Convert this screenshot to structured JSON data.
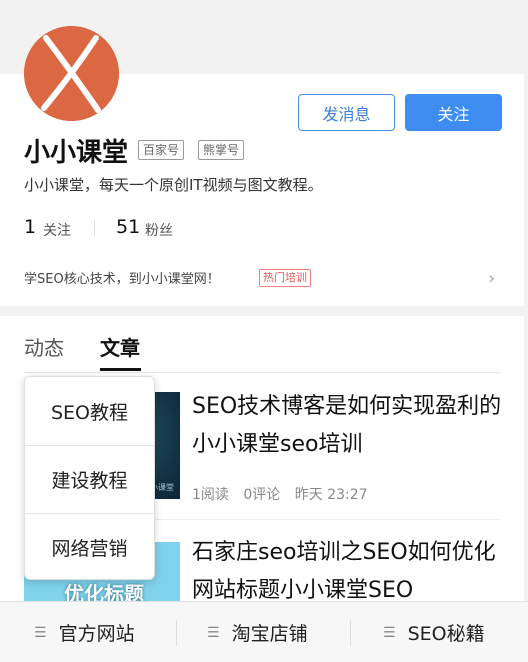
{
  "profile": {
    "name": "小小课堂",
    "badges": [
      "百家号",
      "熊掌号"
    ],
    "description": "小小课堂，每天一个原创IT视频与图文教程。",
    "follow_count": "1",
    "follow_label": "关注",
    "fans_count": "51",
    "fans_label": "粉丝",
    "promo_text": "学SEO核心技术，到小小课堂网！",
    "promo_tag": "热门培训",
    "message_button": "发消息",
    "follow_button": "关注",
    "avatar_icon": "x-logo-icon",
    "avatar_color": "#dc6743",
    "accent_color": "#3d8ef0"
  },
  "tabs": [
    "动态",
    "文章"
  ],
  "active_tab": "文章",
  "articles": [
    {
      "title": "SEO技术博客是如何实现盈利的小小课堂seo培训",
      "reads": "1阅读",
      "comments": "0评论",
      "time": "昨天 23:27",
      "thumb_caption": "小小课堂"
    },
    {
      "title": "石家庄seo培训之SEO如何优化网站标题小小课堂SEO",
      "thumb_text": "优化标题"
    }
  ],
  "dropdown": {
    "items": [
      "SEO教程",
      "建设教程",
      "网络营销"
    ]
  },
  "bottom_nav": {
    "items": [
      "官方网站",
      "淘宝店铺",
      "SEO秘籍"
    ],
    "icon": "menu-lines-icon"
  }
}
